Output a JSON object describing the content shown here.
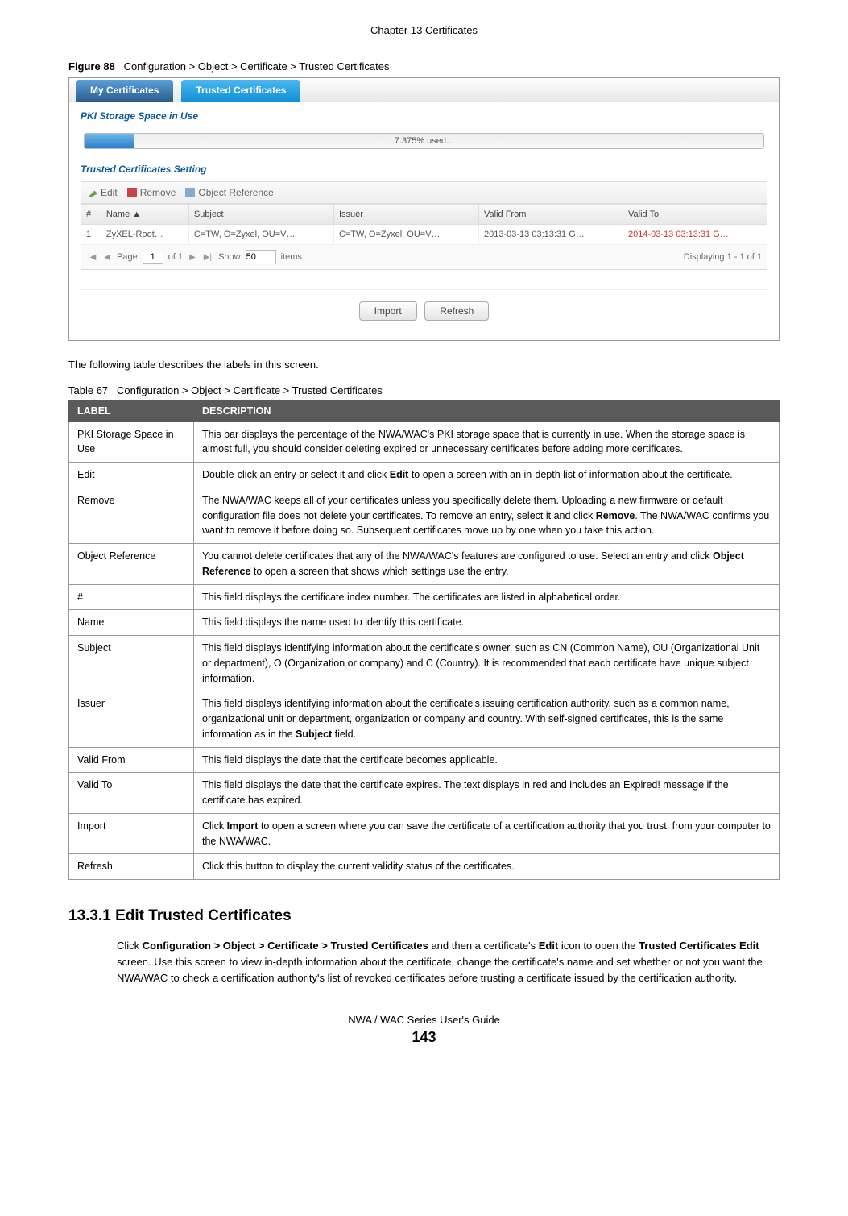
{
  "header": {
    "chapter": "Chapter 13 Certificates"
  },
  "figure": {
    "label": "Figure 88",
    "caption": "Configuration > Object > Certificate > Trusted Certificates"
  },
  "screenshot": {
    "tabs": {
      "inactive": "My Certificates",
      "active": "Trusted Certificates"
    },
    "pki_title": "PKI Storage Space in Use",
    "progress_label": "7.375% used...",
    "setting_title": "Trusted Certificates Setting",
    "toolbar": {
      "edit": "Edit",
      "remove": "Remove",
      "objref": "Object Reference"
    },
    "columns": {
      "num": "#",
      "name": "Name ▲",
      "subject": "Subject",
      "issuer": "Issuer",
      "valid_from": "Valid From",
      "valid_to": "Valid To"
    },
    "row": {
      "num": "1",
      "name": "ZyXEL-Root…",
      "subject": "C=TW, O=Zyxel, OU=V…",
      "issuer": "C=TW, O=Zyxel, OU=V…",
      "valid_from": "2013-03-13 03:13:31 G…",
      "valid_to": "2014-03-13 03:13:31 G…"
    },
    "pager": {
      "page_lbl": "Page",
      "page_val": "1",
      "of": "of 1",
      "show_lbl": "Show",
      "show_val": "50",
      "items": "items",
      "display": "Displaying 1 - 1 of 1"
    },
    "buttons": {
      "import": "Import",
      "refresh": "Refresh"
    }
  },
  "intro_text": "The following table describes the labels in this screen.",
  "table_caption": {
    "label": "Table 67",
    "caption": "Configuration > Object > Certificate > Trusted Certificates"
  },
  "headers": {
    "label": "LABEL",
    "desc": "DESCRIPTION"
  },
  "rows": [
    {
      "label": "PKI Storage Space in Use",
      "desc": "This bar displays the percentage of the NWA/WAC's PKI storage space that is currently in use. When the storage space is almost full, you should consider deleting expired or unnecessary certificates before adding more certificates."
    },
    {
      "label": "Edit",
      "desc_pre": "Double-click an entry or select it and click ",
      "desc_b": "Edit",
      "desc_post": " to open a screen with an in-depth list of information about the certificate."
    },
    {
      "label": "Remove",
      "desc_pre": "The NWA/WAC keeps all of your certificates unless you specifically delete them. Uploading a new firmware or default configuration file does not delete your certificates. To remove an entry, select it and click ",
      "desc_b": "Remove",
      "desc_post": ". The NWA/WAC confirms you want to remove it before doing so. Subsequent certificates move up by one when you take this action."
    },
    {
      "label": "Object Reference",
      "desc_pre": "You cannot delete certificates that any of the NWA/WAC's features are configured to use. Select an entry and click ",
      "desc_b": "Object Reference",
      "desc_post": " to open a screen that shows which settings use the entry."
    },
    {
      "label": "#",
      "desc": "This field displays the certificate index number. The certificates are listed in alphabetical order."
    },
    {
      "label": "Name",
      "desc": "This field displays the name used to identify this certificate."
    },
    {
      "label": "Subject",
      "desc": "This field displays identifying information about the certificate's owner, such as CN (Common Name), OU (Organizational Unit or department), O (Organization or company) and C (Country). It is recommended that each certificate have unique subject information."
    },
    {
      "label": "Issuer",
      "desc_pre": "This field displays identifying information about the certificate's issuing certification authority, such as a common name, organizational unit or department, organization or company and country. With self-signed certificates, this is the same information as in the ",
      "desc_b": "Subject",
      "desc_post": " field."
    },
    {
      "label": "Valid From",
      "desc": "This field displays the date that the certificate becomes applicable."
    },
    {
      "label": "Valid To",
      "desc": "This field displays the date that the certificate expires. The text displays in red and includes an Expired! message if the certificate has expired."
    },
    {
      "label": "Import",
      "desc_pre": "Click ",
      "desc_b": "Import",
      "desc_post": " to open a screen where you can save the certificate of a certification authority that you trust, from your computer to the NWA/WAC."
    },
    {
      "label": "Refresh",
      "desc": "Click this button to display the current validity status of the certificates."
    }
  ],
  "section": {
    "heading": "13.3.1  Edit Trusted Certificates",
    "p1a": "Click ",
    "p1b": "Configuration > Object > Certificate > Trusted Certificates",
    "p1c": " and then a certificate's ",
    "p1d": "Edit",
    "p1e": " icon to open the ",
    "p1f": "Trusted Certificates Edit",
    "p1g": " screen. Use this screen to view in-depth information about the certificate, change the certificate's name and set whether or not you want the NWA/WAC to check a certification authority's list of revoked certificates before trusting a certificate issued by the certification authority."
  },
  "footer": {
    "guide": "NWA / WAC Series User's Guide",
    "page": "143"
  }
}
